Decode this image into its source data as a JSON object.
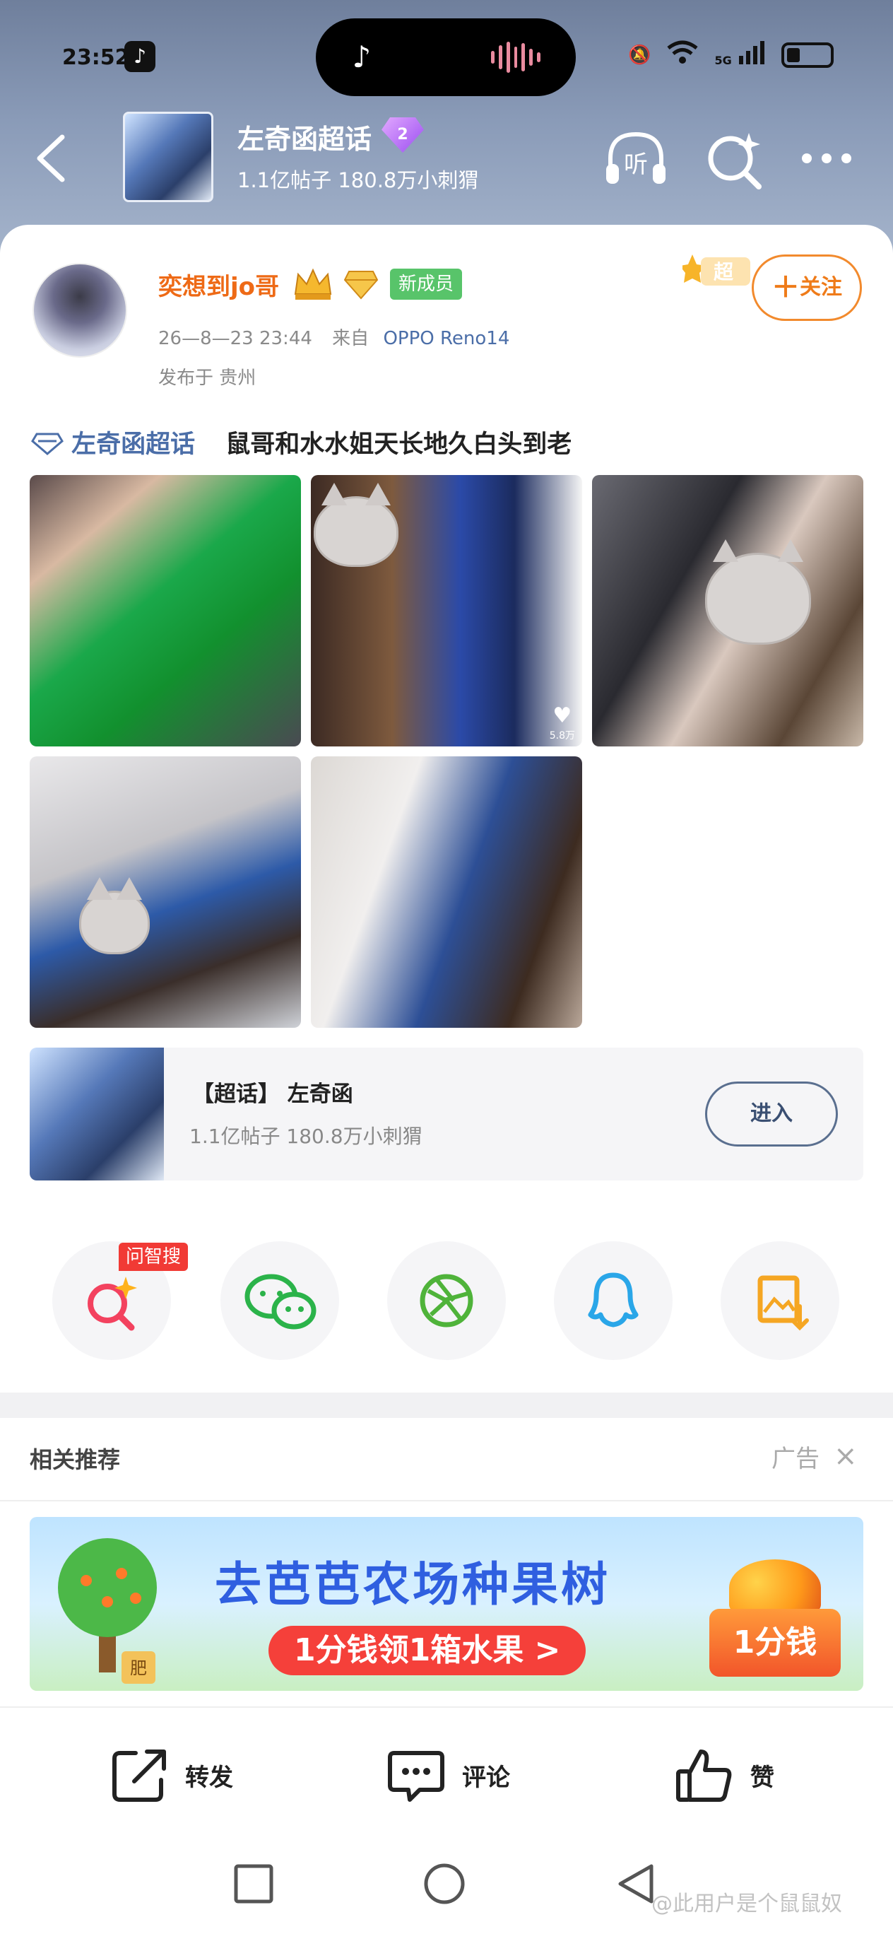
{
  "status_bar": {
    "time": "23:52",
    "network": "5G",
    "sim": "6"
  },
  "nav": {
    "topic_title": "左奇函超话",
    "topic_level": "2",
    "topic_stats": "1.1亿帖子  180.8万小刺猬",
    "listen_label": "听"
  },
  "post": {
    "username": "奕想到jo哥",
    "new_member_badge": "新成员",
    "timestamp": "26—8—23  23:44",
    "from_label": "来自",
    "device": "OPPO  Reno14",
    "location": "发布于  贵州",
    "super_tag": "超",
    "follow_label": "关注",
    "topic_link": "左奇函超话",
    "body": "鼠哥和水水姐天长地久白头到老",
    "photo2_likes": "5.8万"
  },
  "topic_card": {
    "title": "【超话】 左奇函",
    "stats": "1.1亿帖子  180.8万小刺猬",
    "enter_label": "进入"
  },
  "share": {
    "zhisou_tag": "问智搜",
    "items": [
      "zhisou-search",
      "wechat",
      "moments",
      "qq",
      "save-image"
    ]
  },
  "related": {
    "title": "相关推荐",
    "ad_label": "广告",
    "ad_close": "×"
  },
  "ad": {
    "headline": "去芭芭农场种果树",
    "cta": "1分钱领1箱水果 >",
    "badge": "1分钱",
    "tree_tag": "肥"
  },
  "actions": {
    "repost": "转发",
    "comment": "评论",
    "like": "赞"
  },
  "watermark": "@此用户是个鼠鼠奴",
  "colors": {
    "accent_orange": "#ef7b19",
    "link_blue": "#4b6ea8",
    "red": "#f13a35",
    "green_badge": "#58c46a"
  }
}
